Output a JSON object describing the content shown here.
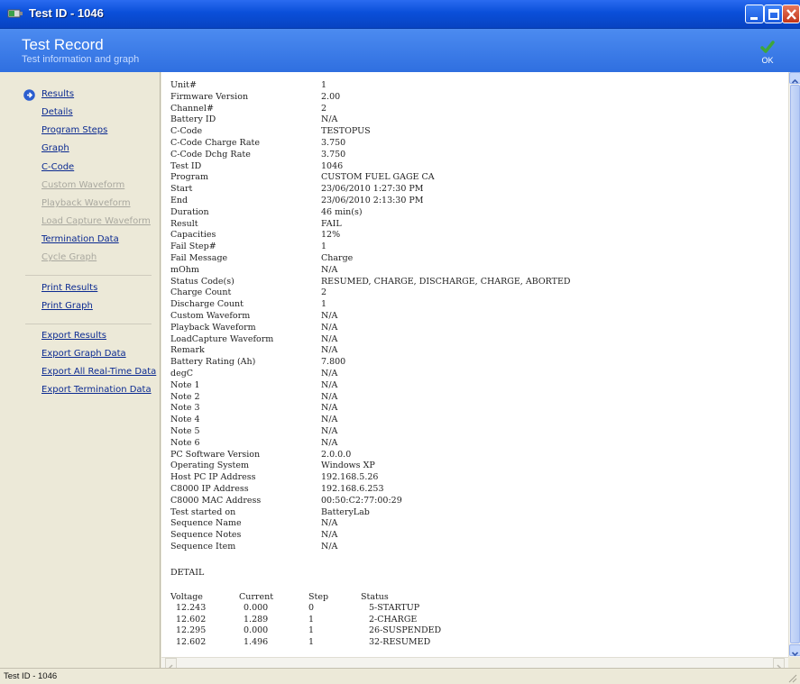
{
  "window": {
    "title": "Test ID - 1046"
  },
  "header": {
    "title": "Test Record",
    "subtitle": "Test information and graph",
    "ok_label": "OK"
  },
  "sidebar": {
    "items": [
      {
        "label": "Results",
        "enabled": true
      },
      {
        "label": "Details",
        "enabled": true
      },
      {
        "label": "Program Steps",
        "enabled": true
      },
      {
        "label": "Graph",
        "enabled": true
      },
      {
        "label": "C-Code",
        "enabled": true
      },
      {
        "label": "Custom Waveform",
        "enabled": false
      },
      {
        "label": "Playback Waveform",
        "enabled": false
      },
      {
        "label": "Load Capture Waveform",
        "enabled": false
      },
      {
        "label": "Termination Data",
        "enabled": true
      },
      {
        "label": "Cycle Graph",
        "enabled": false
      },
      {
        "label": "Print Results",
        "enabled": true
      },
      {
        "label": "Print Graph",
        "enabled": true
      },
      {
        "label": "Export Results",
        "enabled": true
      },
      {
        "label": "Export Graph Data",
        "enabled": true
      },
      {
        "label": "Export All Real-Time Data",
        "enabled": true
      },
      {
        "label": "Export Termination Data",
        "enabled": true
      }
    ]
  },
  "results": {
    "fields": [
      {
        "label": "Unit#",
        "value": "1"
      },
      {
        "label": "Firmware Version",
        "value": "2.00"
      },
      {
        "label": "Channel#",
        "value": "2"
      },
      {
        "label": "Battery ID",
        "value": "N/A"
      },
      {
        "label": "C-Code",
        "value": "TESTOPUS"
      },
      {
        "label": "C-Code Charge Rate",
        "value": "3.750"
      },
      {
        "label": "C-Code Dchg Rate",
        "value": "3.750"
      },
      {
        "label": "Test ID",
        "value": "1046"
      },
      {
        "label": "Program",
        "value": "CUSTOM FUEL GAGE CA"
      },
      {
        "label": "Start",
        "value": "23/06/2010 1:27:30 PM"
      },
      {
        "label": "End",
        "value": "23/06/2010 2:13:30 PM"
      },
      {
        "label": "Duration",
        "value": "46 min(s)"
      },
      {
        "label": "Result",
        "value": "FAIL"
      },
      {
        "label": "Capacities",
        "value": "12%"
      },
      {
        "label": "Fail Step#",
        "value": "1"
      },
      {
        "label": "Fail Message",
        "value": "Charge"
      },
      {
        "label": "mOhm",
        "value": "N/A"
      },
      {
        "label": "Status Code(s)",
        "value": "RESUMED, CHARGE, DISCHARGE, CHARGE, ABORTED"
      },
      {
        "label": "Charge Count",
        "value": "2"
      },
      {
        "label": "Discharge Count",
        "value": "1"
      },
      {
        "label": "Custom Waveform",
        "value": "N/A"
      },
      {
        "label": "Playback Waveform",
        "value": "N/A"
      },
      {
        "label": "LoadCapture Waveform",
        "value": "N/A"
      },
      {
        "label": "Remark",
        "value": "N/A"
      },
      {
        "label": "Battery Rating (Ah)",
        "value": "7.800"
      },
      {
        "label": "degC",
        "value": "N/A"
      },
      {
        "label": "Note 1",
        "value": "N/A"
      },
      {
        "label": "Note 2",
        "value": "N/A"
      },
      {
        "label": "Note 3",
        "value": "N/A"
      },
      {
        "label": "Note 4",
        "value": "N/A"
      },
      {
        "label": "Note 5",
        "value": "N/A"
      },
      {
        "label": "Note 6",
        "value": "N/A"
      },
      {
        "label": "PC Software Version",
        "value": "2.0.0.0"
      },
      {
        "label": "Operating System",
        "value": "Windows XP"
      },
      {
        "label": "Host PC IP Address",
        "value": "192.168.5.26"
      },
      {
        "label": "C8000 IP Address",
        "value": "192.168.6.253"
      },
      {
        "label": "C8000 MAC Address",
        "value": "00:50:C2:77:00:29"
      },
      {
        "label": "Test started on",
        "value": "BatteryLab"
      },
      {
        "label": "Sequence Name",
        "value": "N/A"
      },
      {
        "label": "Sequence Notes",
        "value": "N/A"
      },
      {
        "label": "Sequence Item",
        "value": "N/A"
      }
    ],
    "detail_heading": "DETAIL",
    "detail_columns": [
      "Voltage",
      "Current",
      "Step",
      "Status"
    ],
    "detail_rows": [
      [
        "12.243",
        "0.000",
        "0",
        "5-STARTUP"
      ],
      [
        "12.602",
        "1.289",
        "1",
        "2-CHARGE"
      ],
      [
        "12.295",
        "0.000",
        "1",
        "26-SUSPENDED"
      ],
      [
        "12.602",
        "1.496",
        "1",
        "32-RESUMED"
      ]
    ]
  },
  "statusbar": {
    "text": "Test ID - 1046"
  },
  "colors": {
    "titlebar": "#0a4fd9",
    "header": "#3d7de8",
    "link": "#0b2a91",
    "disabled": "#a9a89f"
  }
}
